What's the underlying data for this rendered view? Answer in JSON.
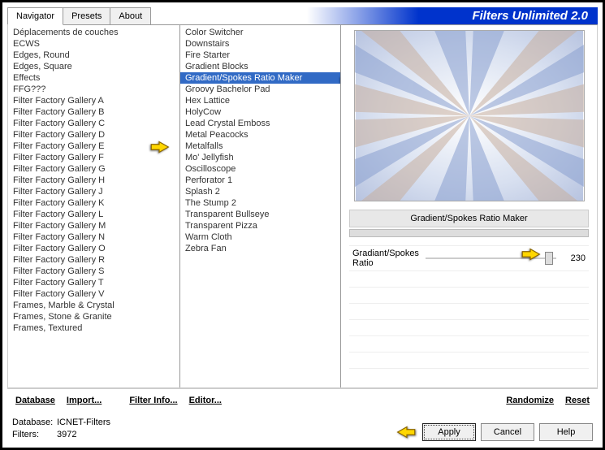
{
  "app_title": "Filters Unlimited 2.0",
  "tabs": [
    "Navigator",
    "Presets",
    "About"
  ],
  "categories": [
    "Déplacements de couches",
    "ECWS",
    "Edges, Round",
    "Edges, Square",
    "Effects",
    "FFG???",
    "Filter Factory Gallery A",
    "Filter Factory Gallery B",
    "Filter Factory Gallery C",
    "Filter Factory Gallery D",
    "Filter Factory Gallery E",
    "Filter Factory Gallery F",
    "Filter Factory Gallery G",
    "Filter Factory Gallery H",
    "Filter Factory Gallery J",
    "Filter Factory Gallery K",
    "Filter Factory Gallery L",
    "Filter Factory Gallery M",
    "Filter Factory Gallery N",
    "Filter Factory Gallery O",
    "Filter Factory Gallery R",
    "Filter Factory Gallery S",
    "Filter Factory Gallery T",
    "Filter Factory Gallery V",
    "Frames, Marble & Crystal",
    "Frames, Stone & Granite",
    "Frames, Textured"
  ],
  "filters": [
    "Color Switcher",
    "Downstairs",
    "Fire Starter",
    "Gradient Blocks",
    "Gradient/Spokes Ratio Maker",
    "Groovy Bachelor Pad",
    "Hex Lattice",
    "HolyCow",
    "Lead Crystal Emboss",
    "Metal Peacocks",
    "Metalfalls",
    "Mo' Jellyfish",
    "Oscilloscope",
    "Perforator 1",
    "Splash 2",
    "The Stump 2",
    "Transparent Bullseye",
    "Transparent Pizza",
    "Warm Cloth",
    "Zebra Fan"
  ],
  "selected_filter": "Gradient/Spokes Ratio Maker",
  "param": {
    "label": "Gradiant/Spokes Ratio",
    "value": "230"
  },
  "links": {
    "database": "Database",
    "import": "Import...",
    "filterinfo": "Filter Info...",
    "editor": "Editor...",
    "randomize": "Randomize",
    "reset": "Reset"
  },
  "status": {
    "db_label": "Database:",
    "db_value": "ICNET-Filters",
    "filters_label": "Filters:",
    "filters_value": "3972"
  },
  "buttons": {
    "apply": "Apply",
    "cancel": "Cancel",
    "help": "Help"
  }
}
